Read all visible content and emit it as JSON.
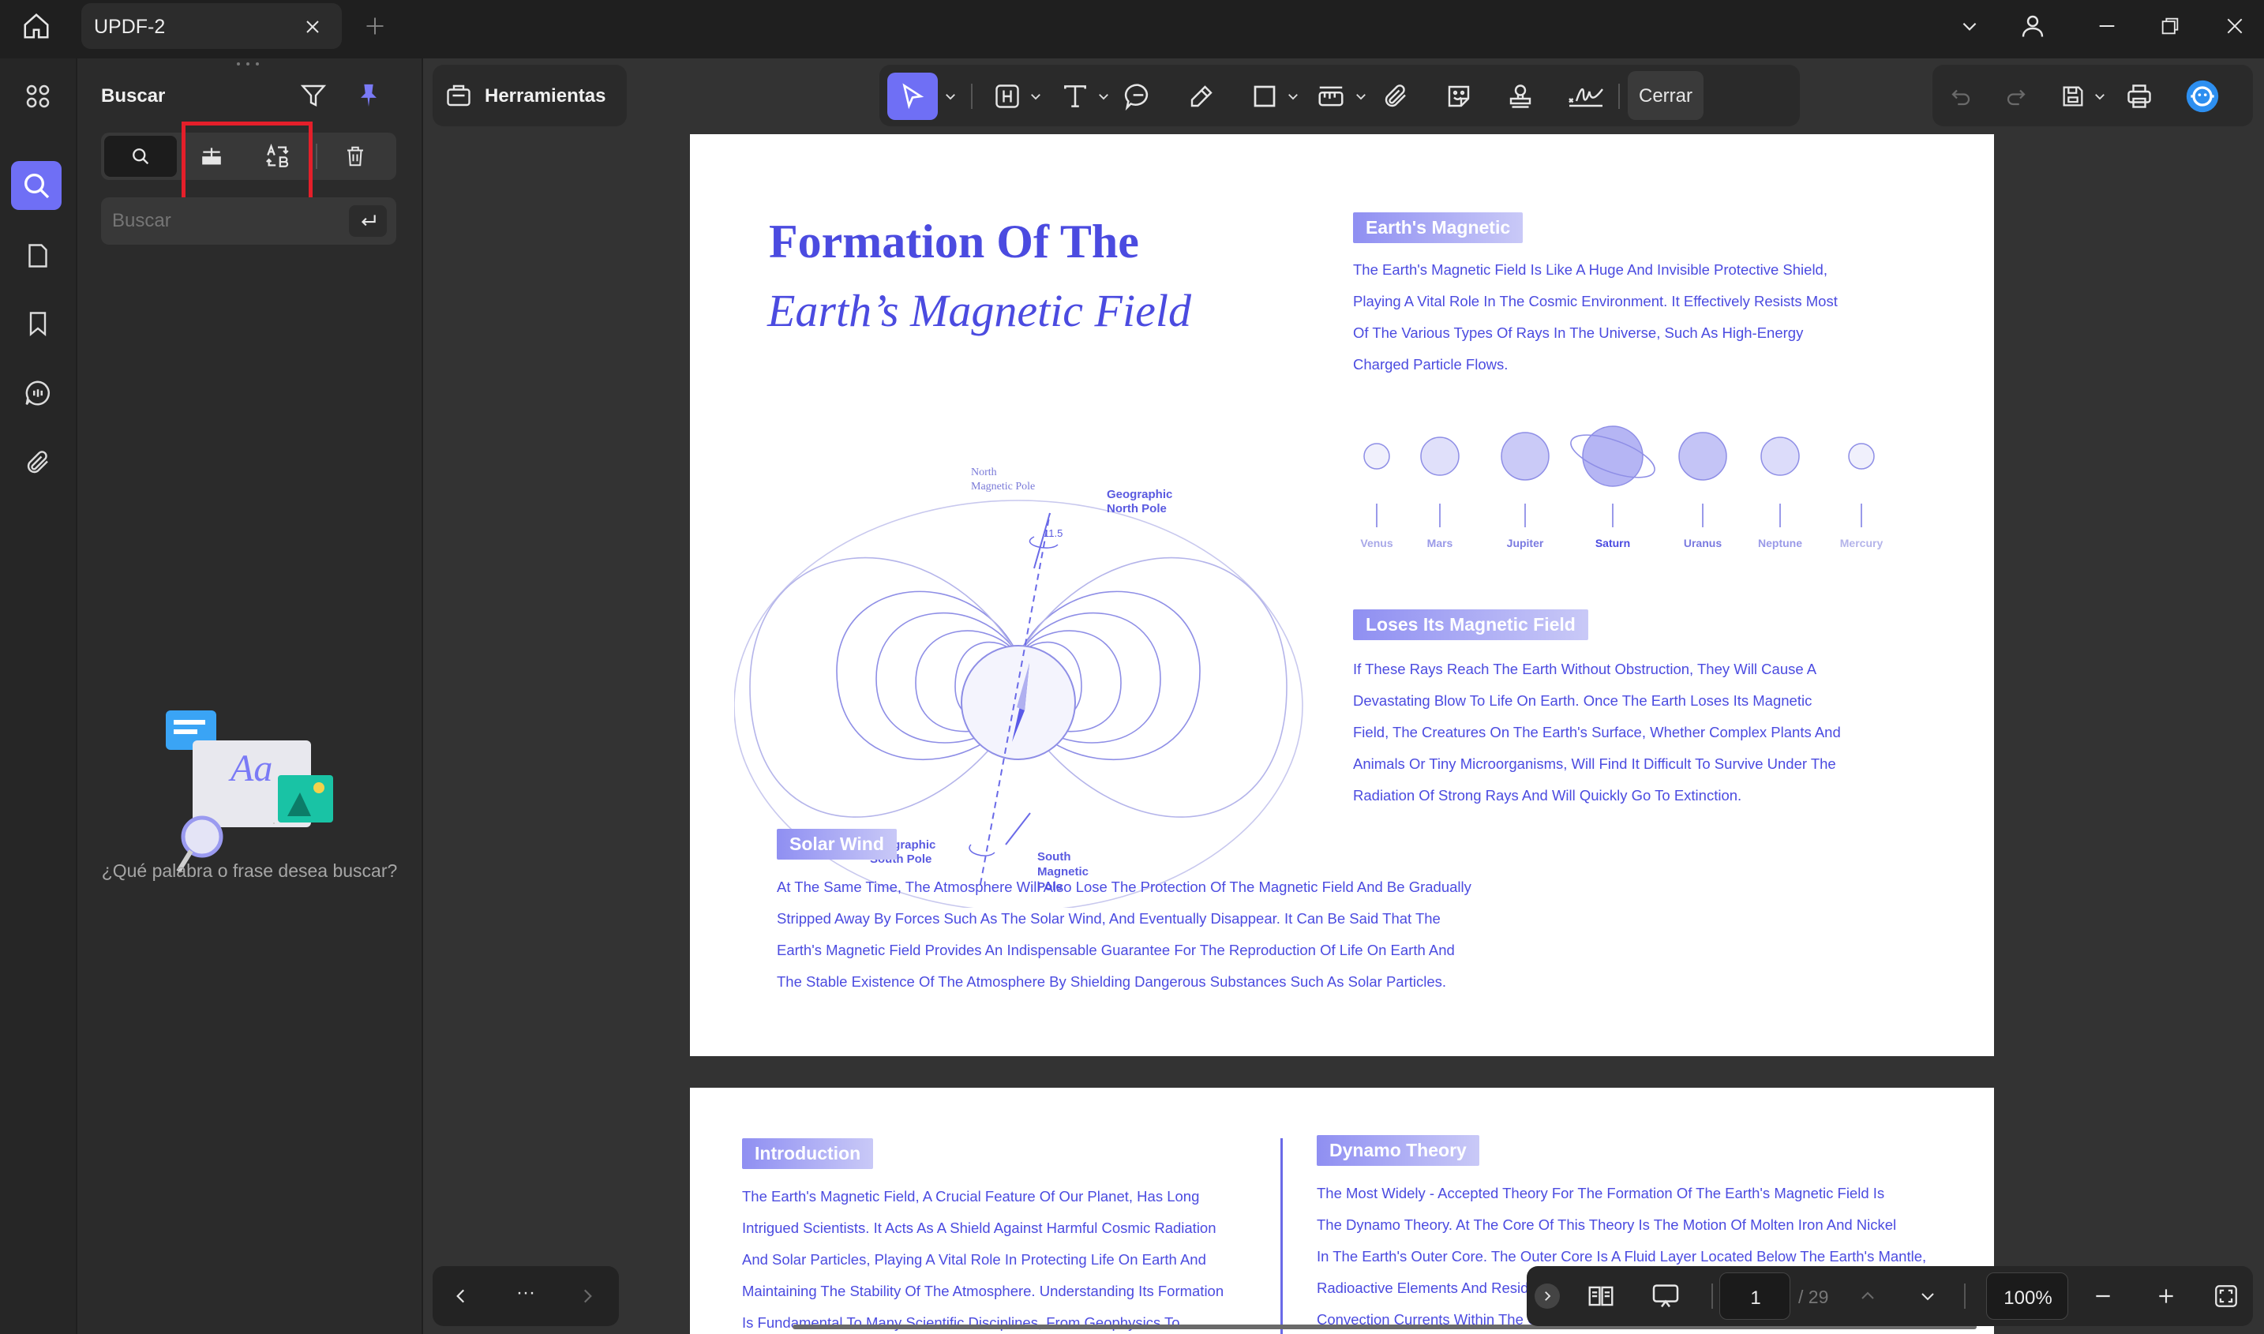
{
  "tab": {
    "title": "UPDF-2"
  },
  "panel": {
    "title": "Buscar",
    "search_placeholder": "Buscar",
    "empty_message": "¿Qué palabra o frase desea buscar?",
    "illus_text": "Aa"
  },
  "toolbar": {
    "tools_label": "Herramientas",
    "close_label": "Cerrar"
  },
  "accent": "#4f4fe8",
  "page1": {
    "title_line1": "Formation Of The",
    "title_line2": "Earth’s Magnetic Field",
    "diagram": {
      "north_magnetic_pole": "North\nMagnetic Pole",
      "geographic_north_pole": "Geographic\nNorth Pole",
      "angle": "11.5",
      "geographic_south_pole": "Geographic\nSouth Pole",
      "south_magnetic_pole": "South\nMagnetic\nPole"
    },
    "earths_magnetic": {
      "heading": "Earth's Magnetic",
      "lines": [
        "The Earth's Magnetic Field Is Like A Huge And Invisible Protective Shield,",
        "Playing A Vital Role In The Cosmic Environment. It Effectively Resists Most",
        "Of The Various Types Of Rays In The Universe, Such As High-Energy",
        "Charged Particle Flows."
      ]
    },
    "planets": [
      "Venus",
      "Mars",
      "Jupiter",
      "Saturn",
      "Uranus",
      "Neptune",
      "Mercury"
    ],
    "loses": {
      "heading": "Loses Its Magnetic Field",
      "lines": [
        "If These Rays Reach The Earth Without Obstruction, They Will Cause A",
        "Devastating Blow To Life On Earth. Once The Earth Loses Its Magnetic",
        "Field, The Creatures On The Earth's Surface, Whether Complex Plants And",
        "Animals Or Tiny Microorganisms, Will Find It Difficult To Survive Under The",
        "Radiation Of Strong Rays And Will Quickly Go To Extinction."
      ]
    },
    "solar_wind": {
      "heading": "Solar Wind",
      "lines": [
        "At The Same Time, The Atmosphere Will Also Lose The Protection Of The Magnetic Field And Be Gradually",
        "Stripped Away By Forces Such As The Solar Wind, And Eventually Disappear. It Can Be Said That The",
        "Earth's Magnetic Field Provides An Indispensable Guarantee For The Reproduction Of Life On Earth And",
        "The Stable Existence Of The Atmosphere By Shielding Dangerous Substances Such As Solar Particles."
      ]
    }
  },
  "page2": {
    "introduction": {
      "heading": "Introduction",
      "lines": [
        "The Earth's Magnetic Field, A Crucial Feature Of Our Planet, Has Long",
        "Intrigued Scientists. It Acts As A Shield Against Harmful Cosmic Radiation",
        "And Solar Particles, Playing A Vital Role In Protecting Life On Earth And",
        "Maintaining The Stability Of The Atmosphere. Understanding Its Formation",
        "Is Fundamental To Many Scientific Disciplines, From Geophysics To"
      ]
    },
    "dynamo": {
      "heading": "Dynamo Theory",
      "lines": [
        "The Most Widely - Accepted Theory For The Formation Of The Earth's Magnetic Field Is",
        "The Dynamo Theory. At The Core Of This Theory Is The Motion Of Molten Iron And Nickel",
        "In The Earth's Outer Core. The Outer Core Is A Fluid Layer Located Below The Earth's Mantle,",
        "Radioactive Elements And Residual Heat From The Planet's Formation.",
        "Convection Currents Within The Outer"
      ]
    }
  },
  "bottom_nav": {
    "more": "···"
  },
  "page_nav": {
    "current_page": "1",
    "total": "/ 29",
    "zoom": "100%"
  }
}
